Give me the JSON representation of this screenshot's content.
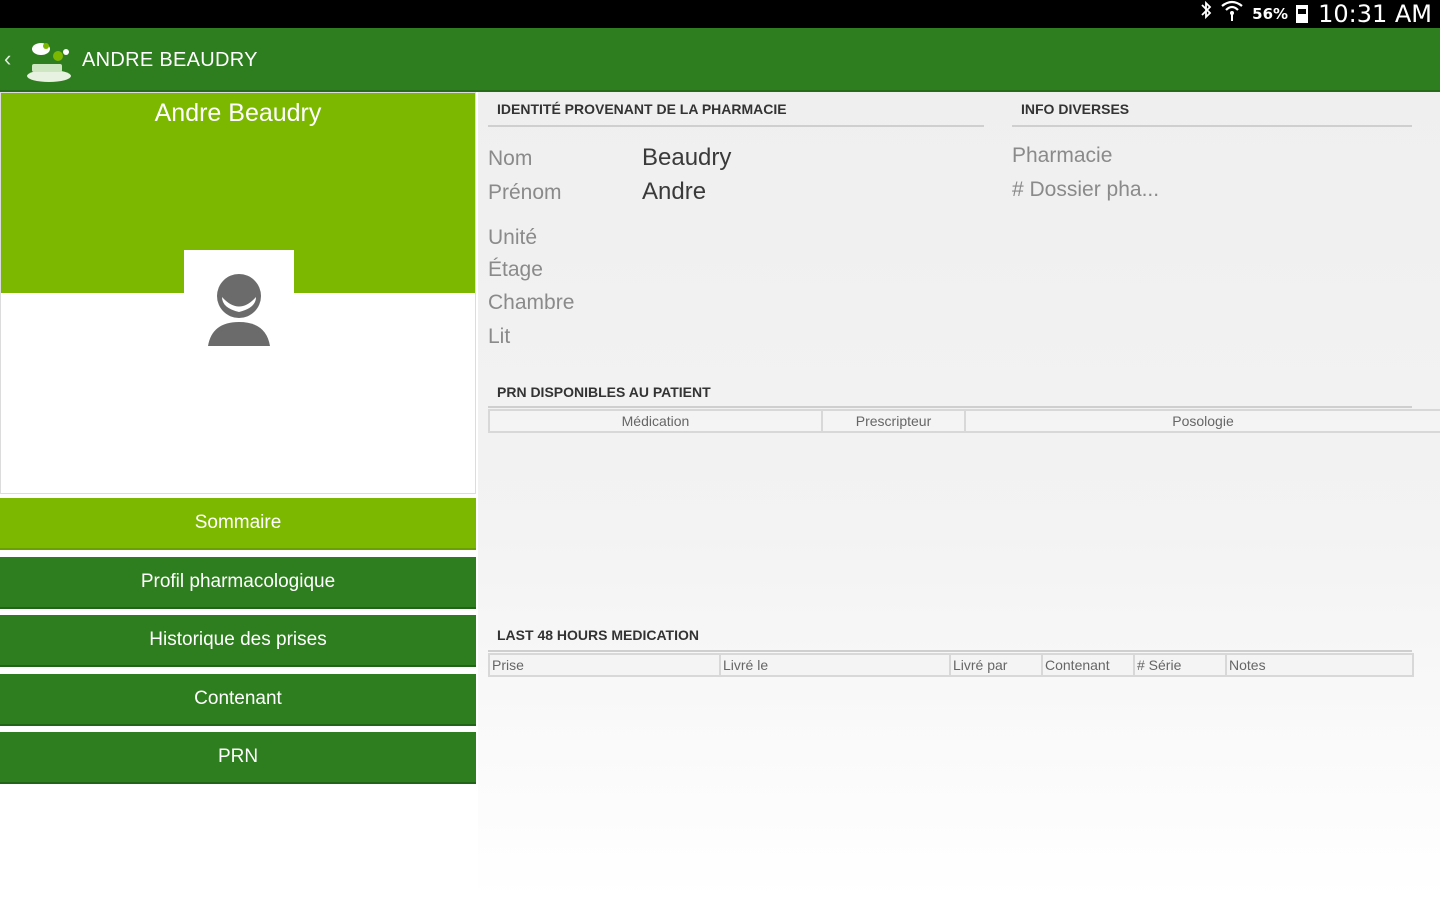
{
  "status_bar": {
    "icons": [
      "bluetooth-icon",
      "wifi-icon",
      "battery-icon"
    ],
    "battery": "56%",
    "time": "10:31 AM"
  },
  "action_bar": {
    "title": "ANDRE BEAUDRY",
    "back_glyph": "‹"
  },
  "profile": {
    "name": "Andre Beaudry"
  },
  "nav": [
    {
      "label": "Sommaire",
      "active": true
    },
    {
      "label": "Profil pharmacologique",
      "active": false
    },
    {
      "label": "Historique des prises",
      "active": false
    },
    {
      "label": "Contenant",
      "active": false
    },
    {
      "label": "PRN",
      "active": false
    }
  ],
  "identity": {
    "header": "IDENTITÉ PROVENANT DE LA PHARMACIE",
    "nom_label": "Nom",
    "nom_value": "Beaudry",
    "prenom_label": "Prénom",
    "prenom_value": "Andre",
    "unite_label": "Unité",
    "etage_label": "Étage",
    "chambre_label": "Chambre",
    "lit_label": "Lit"
  },
  "info": {
    "header": "INFO DIVERSES",
    "pharmacie_label": "Pharmacie",
    "dossier_label": "# Dossier pha..."
  },
  "prn": {
    "header": "PRN DISPONIBLES AU PATIENT",
    "columns": [
      "Médication",
      "Prescripteur",
      "Posologie"
    ]
  },
  "last48": {
    "header": "LAST 48 HOURS MEDICATION",
    "columns": [
      "Prise",
      "Livré le",
      "Livré par",
      "Contenant",
      "# Série",
      "Notes"
    ]
  },
  "colors": {
    "action_bar": "#2e7d1f",
    "accent_light": "#7cb800",
    "nav_dark": "#2e7d1f"
  }
}
